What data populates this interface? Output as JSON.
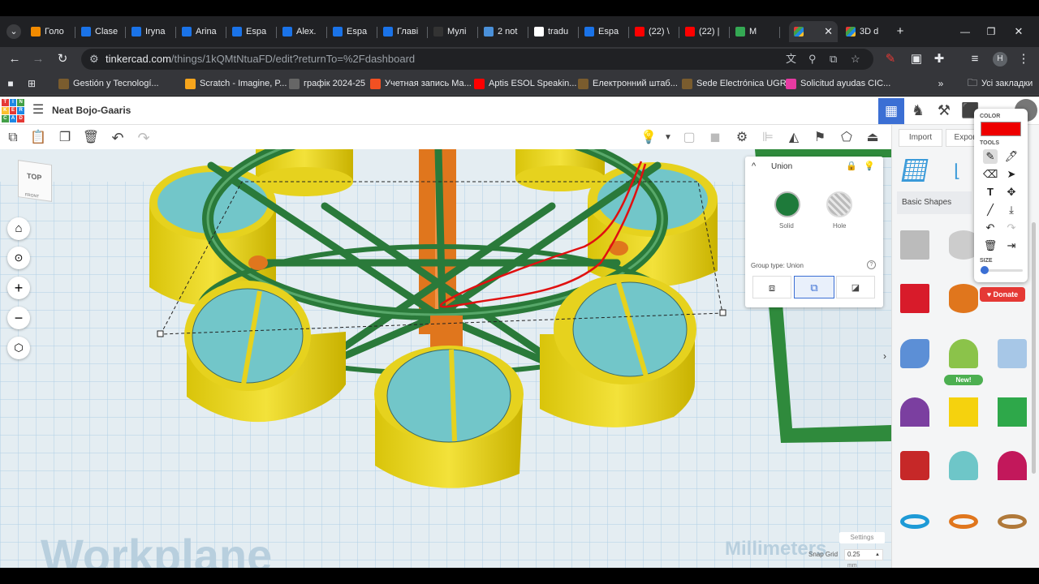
{
  "browser": {
    "tabs": [
      {
        "label": "Голо",
        "fav": "#f28b00"
      },
      {
        "label": "Clase",
        "fav": "#1a73e8"
      },
      {
        "label": "Iryna",
        "fav": "#1a73e8"
      },
      {
        "label": "Arina",
        "fav": "#1a73e8"
      },
      {
        "label": "Espa",
        "fav": "#1a73e8"
      },
      {
        "label": "Alex.",
        "fav": "#1a73e8"
      },
      {
        "label": "Espa",
        "fav": "#1a73e8"
      },
      {
        "label": "Главі",
        "fav": "#1a73e8"
      },
      {
        "label": "Мулі",
        "fav": "#333"
      },
      {
        "label": "2 not",
        "fav": "#4a90d9"
      },
      {
        "label": "tradu",
        "fav": "#ffffff"
      },
      {
        "label": "Espa",
        "fav": "#1a73e8"
      },
      {
        "label": "(22) \\",
        "fav": "#ff0000"
      },
      {
        "label": "(22) |",
        "fav": "#ff0000"
      },
      {
        "label": "M",
        "fav": "#34a853"
      }
    ],
    "active_tab_label": "",
    "last_tab_label": "3D d",
    "url_host": "tinkercad.com",
    "url_path": "/things/1kQMtNtuaFD/edit?returnTo=%2Fdashboard",
    "profile_letter": "H",
    "bookmarks": [
      {
        "label": "Gestión y Tecnologí...",
        "fav": "#7a5c2e"
      },
      {
        "label": "Scratch - Imagine, P...",
        "fav": "#f6a51c"
      },
      {
        "label": "графік 2024-25",
        "fav": "#666"
      },
      {
        "label": "Учетная запись Ма...",
        "fav": "#f25022"
      },
      {
        "label": "Aptis ESOL Speakin...",
        "fav": "#ff0000"
      },
      {
        "label": "Електронний штаб...",
        "fav": "#7a5c2e"
      },
      {
        "label": "Sede Electrónica UGR",
        "fav": "#7a5c2e"
      },
      {
        "label": "Solicitud ayudas CIC...",
        "fav": "#e63aa2"
      }
    ],
    "all_bookmarks_label": "Усі закладки"
  },
  "tinkercad": {
    "logo_letters": [
      "T",
      "I",
      "N",
      "K",
      "E",
      "R",
      "C",
      "A",
      "D"
    ],
    "design_name": "Neat Bojo-Gaaris",
    "import_label": "Import",
    "export_label": "Export",
    "viewcube_top": "TOP",
    "viewcube_front": "FRONT",
    "workplane_label": "Workplane",
    "units_label": "Millimeters",
    "settings_label": "Settings",
    "snap_grid_label": "Snap Grid",
    "snap_grid_value": "0.25",
    "snap_grid_unit": "mm",
    "inspector": {
      "title": "Union",
      "solid_label": "Solid",
      "hole_label": "Hole",
      "group_type_label": "Group type: Union",
      "solid_color": "#1e7a3a"
    },
    "library_label": "Basic Shapes",
    "new_badge": "New!",
    "donate_label": "Donate"
  },
  "palette": {
    "color_label": "COLOR",
    "color_value": "#ee0000",
    "tools_label": "TOOLS",
    "size_label": "SIZE",
    "size_fraction": 0.1
  }
}
